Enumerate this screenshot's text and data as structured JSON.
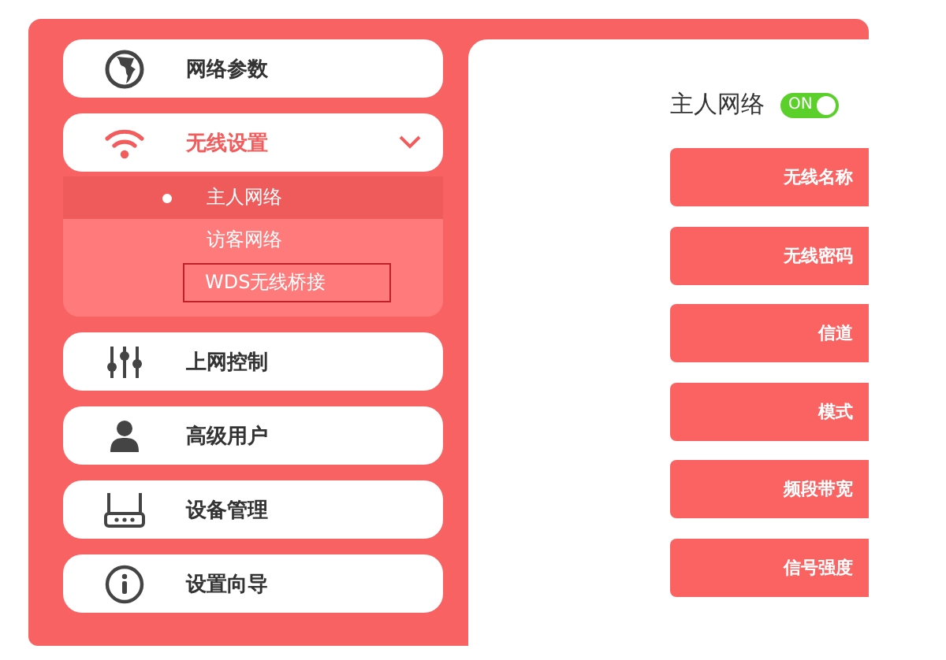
{
  "sidebar": {
    "items": [
      {
        "label": "网络参数",
        "kind": "globe",
        "selected": false
      },
      {
        "label": "无线设置",
        "kind": "wifi",
        "selected": true,
        "expanded": true,
        "children": [
          {
            "label": "主人网络",
            "selected": true,
            "outlined": false
          },
          {
            "label": "访客网络",
            "selected": false,
            "outlined": false
          },
          {
            "label": "WDS无线桥接",
            "selected": false,
            "outlined": true
          }
        ]
      },
      {
        "label": "上网控制",
        "kind": "sliders",
        "selected": false
      },
      {
        "label": "高级用户",
        "kind": "user",
        "selected": false
      },
      {
        "label": "设备管理",
        "kind": "router",
        "selected": false
      },
      {
        "label": "设置向导",
        "kind": "info",
        "selected": false
      }
    ]
  },
  "content": {
    "title": "主人网络",
    "toggle": {
      "on": true,
      "label": "ON"
    },
    "fields": [
      {
        "label": "无线名称"
      },
      {
        "label": "无线密码"
      },
      {
        "label": "信道"
      },
      {
        "label": "模式"
      },
      {
        "label": "频段带宽"
      },
      {
        "label": "信号强度"
      }
    ]
  }
}
